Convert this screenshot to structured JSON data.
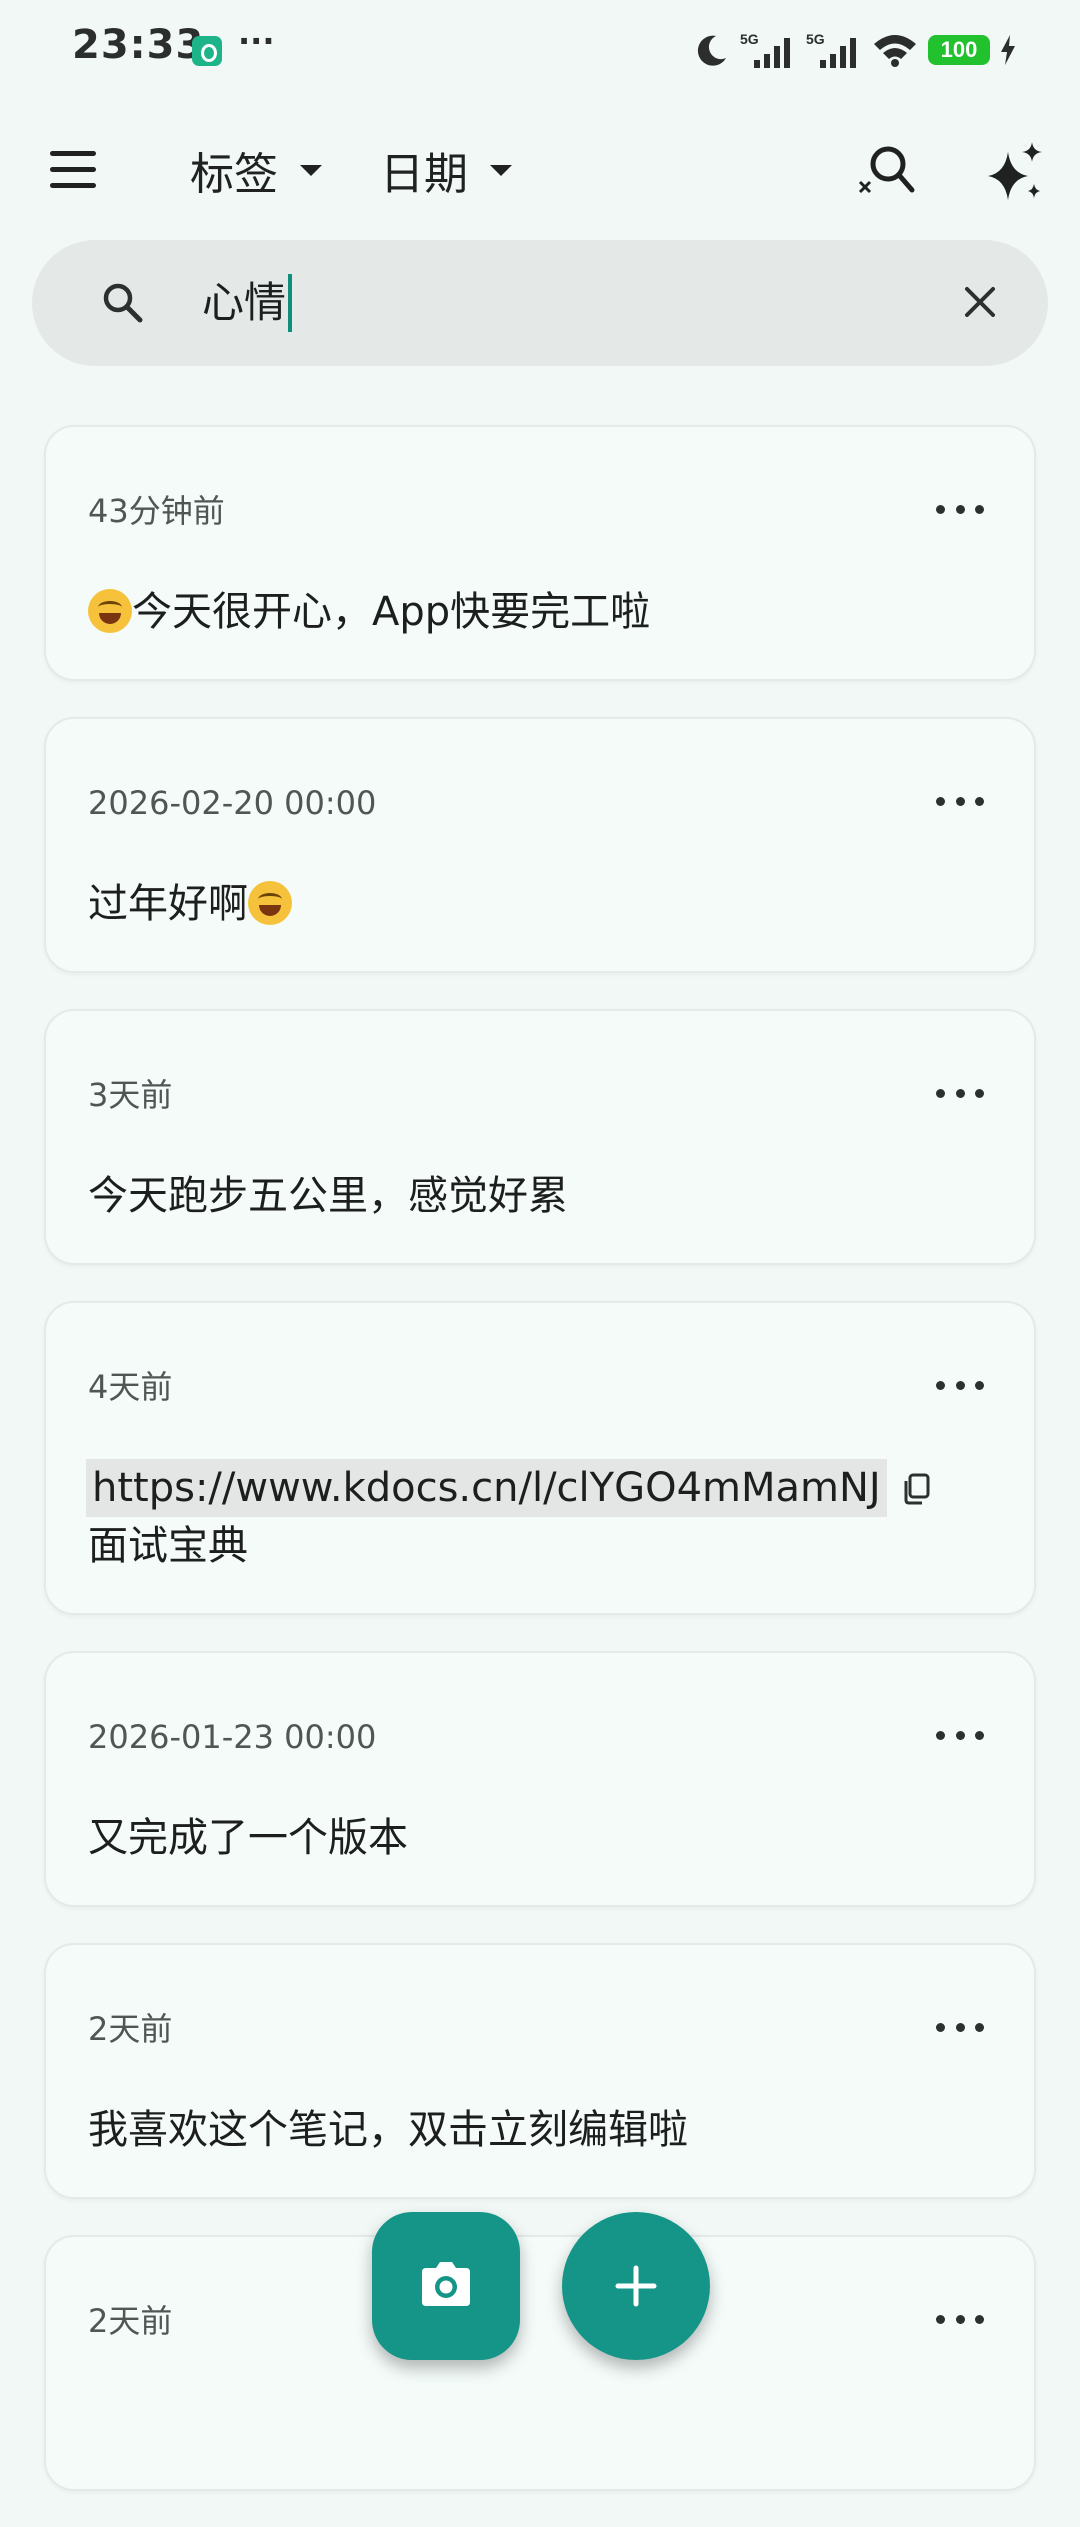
{
  "status_bar": {
    "time": "23:33",
    "more": "···",
    "network_1": "5G",
    "network_2": "5G",
    "battery": "100"
  },
  "app_bar": {
    "filter_tags_label": "标签",
    "filter_date_label": "日期"
  },
  "search": {
    "query": "心情"
  },
  "notes": [
    {
      "time": "43分钟前",
      "text_before_emoji": "",
      "has_leading_emoji": true,
      "text": "今天很开心，App快要完工啦"
    },
    {
      "time": "2026-02-20 00:00",
      "text": "过年好啊",
      "has_trailing_emoji": true
    },
    {
      "time": "3天前",
      "text": "今天跑步五公里，感觉好累"
    },
    {
      "time": "4天前",
      "link": "https://www.kdocs.cn/l/clYGO4mMamNJ",
      "text": "面试宝典"
    },
    {
      "time": "2026-01-23 00:00",
      "text": "又完成了一个版本"
    },
    {
      "time": "2天前",
      "text": "我喜欢这个笔记，双击立刻编辑啦"
    },
    {
      "time": "2天前",
      "text": ""
    }
  ],
  "colors": {
    "accent": "#159588",
    "background": "#f1f8f6",
    "search_bg": "#e4e9e7",
    "battery": "#22c12e"
  },
  "icons": {
    "menu": "menu-icon",
    "advanced_search": "search-icon",
    "ai": "sparkle-icon",
    "search": "search-icon",
    "clear": "close-icon",
    "more": "more-horizontal-icon",
    "copy": "copy-icon",
    "camera": "camera-icon",
    "add": "plus-icon"
  }
}
